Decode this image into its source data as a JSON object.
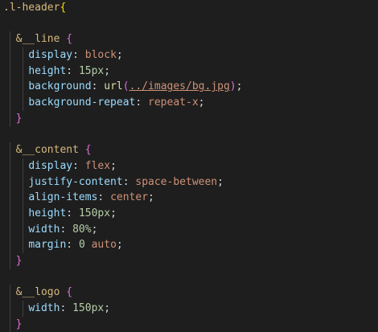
{
  "editor": {
    "lines": [
      {
        "indent": 0,
        "tokens": [
          {
            "t": ".l-header",
            "c": "sel"
          },
          {
            "t": "{",
            "c": "brace1"
          }
        ]
      },
      {
        "indent": 0,
        "tokens": []
      },
      {
        "indent": 1,
        "tokens": [
          {
            "t": "&__line",
            "c": "amp"
          },
          {
            "t": " ",
            "c": "punc"
          },
          {
            "t": "{",
            "c": "brace2"
          }
        ]
      },
      {
        "indent": 2,
        "tokens": [
          {
            "t": "display",
            "c": "prop"
          },
          {
            "t": ": ",
            "c": "punc"
          },
          {
            "t": "block",
            "c": "val"
          },
          {
            "t": ";",
            "c": "punc"
          }
        ]
      },
      {
        "indent": 2,
        "tokens": [
          {
            "t": "height",
            "c": "prop"
          },
          {
            "t": ": ",
            "c": "punc"
          },
          {
            "t": "15px",
            "c": "num"
          },
          {
            "t": ";",
            "c": "punc"
          }
        ]
      },
      {
        "indent": 2,
        "tokens": [
          {
            "t": "background",
            "c": "prop"
          },
          {
            "t": ": ",
            "c": "punc"
          },
          {
            "t": "url",
            "c": "fn"
          },
          {
            "t": "(",
            "c": "paren"
          },
          {
            "t": "../images/bg.jpg",
            "c": "url"
          },
          {
            "t": ")",
            "c": "paren"
          },
          {
            "t": ";",
            "c": "punc"
          }
        ]
      },
      {
        "indent": 2,
        "tokens": [
          {
            "t": "background-repeat",
            "c": "prop"
          },
          {
            "t": ": ",
            "c": "punc"
          },
          {
            "t": "repeat-x",
            "c": "val"
          },
          {
            "t": ";",
            "c": "punc"
          }
        ]
      },
      {
        "indent": 1,
        "tokens": [
          {
            "t": "}",
            "c": "brace2"
          }
        ]
      },
      {
        "indent": 0,
        "tokens": []
      },
      {
        "indent": 1,
        "tokens": [
          {
            "t": "&__content",
            "c": "amp"
          },
          {
            "t": " ",
            "c": "punc"
          },
          {
            "t": "{",
            "c": "brace2"
          }
        ]
      },
      {
        "indent": 2,
        "tokens": [
          {
            "t": "display",
            "c": "prop"
          },
          {
            "t": ": ",
            "c": "punc"
          },
          {
            "t": "flex",
            "c": "val"
          },
          {
            "t": ";",
            "c": "punc"
          }
        ]
      },
      {
        "indent": 2,
        "tokens": [
          {
            "t": "justify-content",
            "c": "prop"
          },
          {
            "t": ": ",
            "c": "punc"
          },
          {
            "t": "space-between",
            "c": "val"
          },
          {
            "t": ";",
            "c": "punc"
          }
        ]
      },
      {
        "indent": 2,
        "tokens": [
          {
            "t": "align-items",
            "c": "prop"
          },
          {
            "t": ": ",
            "c": "punc"
          },
          {
            "t": "center",
            "c": "val"
          },
          {
            "t": ";",
            "c": "punc"
          }
        ]
      },
      {
        "indent": 2,
        "tokens": [
          {
            "t": "height",
            "c": "prop"
          },
          {
            "t": ": ",
            "c": "punc"
          },
          {
            "t": "150px",
            "c": "num"
          },
          {
            "t": ";",
            "c": "punc"
          }
        ]
      },
      {
        "indent": 2,
        "tokens": [
          {
            "t": "width",
            "c": "prop"
          },
          {
            "t": ": ",
            "c": "punc"
          },
          {
            "t": "80%",
            "c": "num"
          },
          {
            "t": ";",
            "c": "punc"
          }
        ]
      },
      {
        "indent": 2,
        "tokens": [
          {
            "t": "margin",
            "c": "prop"
          },
          {
            "t": ": ",
            "c": "punc"
          },
          {
            "t": "0",
            "c": "num"
          },
          {
            "t": " ",
            "c": "punc"
          },
          {
            "t": "auto",
            "c": "val"
          },
          {
            "t": ";",
            "c": "punc"
          }
        ]
      },
      {
        "indent": 1,
        "tokens": [
          {
            "t": "}",
            "c": "brace2"
          }
        ]
      },
      {
        "indent": 0,
        "tokens": []
      },
      {
        "indent": 1,
        "tokens": [
          {
            "t": "&__logo",
            "c": "amp"
          },
          {
            "t": " ",
            "c": "punc"
          },
          {
            "t": "{",
            "c": "brace2"
          }
        ]
      },
      {
        "indent": 2,
        "tokens": [
          {
            "t": "width",
            "c": "prop"
          },
          {
            "t": ": ",
            "c": "punc"
          },
          {
            "t": "150px",
            "c": "num"
          },
          {
            "t": ";",
            "c": "punc"
          }
        ]
      },
      {
        "indent": 1,
        "tokens": [
          {
            "t": "}",
            "c": "brace2"
          }
        ]
      }
    ]
  }
}
